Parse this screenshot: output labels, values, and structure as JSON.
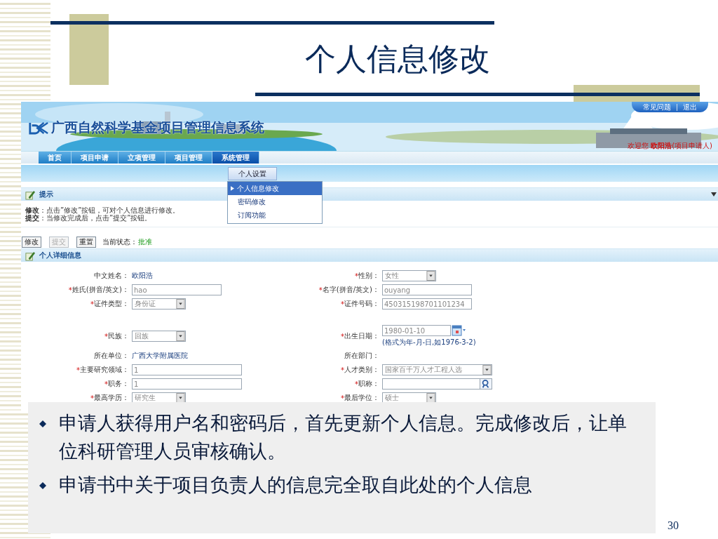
{
  "slide": {
    "title": "个人信息修改",
    "page_number": "30",
    "bullets": [
      "申请人获得用户名和密码后，首先更新个人信息。完成修改后，让单位科研管理人员审核确认。",
      "申请书中关于项目负责人的信息完全取自此处的个人信息"
    ]
  },
  "app": {
    "system_title": "广西自然科学基金项目管理信息系统",
    "top_links": [
      "常见问题",
      "退出"
    ],
    "welcome": "欢迎您 **欧阳浩**(项目申请人)",
    "nav": [
      {
        "label": "首页",
        "selected": false
      },
      {
        "label": "项目申请",
        "selected": false
      },
      {
        "label": "立项管理",
        "selected": false
      },
      {
        "label": "项目管理",
        "selected": false
      },
      {
        "label": "系统管理",
        "selected": true
      }
    ],
    "submenu": "个人设置",
    "dropdown": [
      {
        "label": "个人信息修改",
        "selected": true
      },
      {
        "label": "密码修改",
        "selected": false
      },
      {
        "label": "订阅功能",
        "selected": false
      }
    ],
    "tips_panel": {
      "title": "提示",
      "lines": [
        "**修改**：点击”修改”按钮，可对个人信息进行修改。",
        "**提交**：当修改完成后，点击”提交”按钮。"
      ]
    },
    "actions": [
      {
        "label": "修改",
        "disabled": false
      },
      {
        "label": "提交",
        "disabled": true
      },
      {
        "label": "重置",
        "disabled": false
      }
    ],
    "status": {
      "label": "当前状态：",
      "value": "批准"
    },
    "detail_panel": {
      "title": "个人详细信息",
      "rows": [
        {
          "left": {
            "label": "中文姓名：",
            "kind": "text",
            "value": "欧阳浩"
          },
          "right": {
            "mark": "*",
            "label": "性别：",
            "kind": "select",
            "value": "女性"
          }
        },
        {
          "left": {
            "mark": "*",
            "label": "姓氏(拼音/英文)：",
            "kind": "input",
            "value": "hao"
          },
          "right": {
            "mark": "*",
            "label": "名字(拼音/英文)：",
            "kind": "input",
            "value": "ouyang"
          }
        },
        {
          "left": {
            "mark": "*",
            "label": "证件类型：",
            "kind": "select",
            "value": "身份证"
          },
          "right": {
            "mark": "*",
            "label": "证件号码：",
            "kind": "input",
            "value": "450315198701101234"
          }
        },
        {
          "left": {
            "mark": "*",
            "label": "民族：",
            "kind": "select",
            "value": "回族"
          },
          "right": {
            "mark": "*",
            "label": "出生日期：",
            "kind": "date",
            "value": "1980-01-10",
            "hint": "(格式为年-月-日,如1976-3-2)"
          }
        },
        {
          "left": {
            "label": "所在单位：",
            "kind": "text",
            "value": "广西大学附属医院"
          },
          "right": {
            "label": "所在部门：",
            "kind": "text"
          }
        },
        {
          "left": {
            "mark": "*",
            "label": "主要研究领域：",
            "kind": "input",
            "wide": true,
            "value": "1"
          },
          "right": {
            "mark": "*",
            "label": "人才类别：",
            "kind": "select",
            "wide": true,
            "value": "国家百千万人才工程人选"
          }
        },
        {
          "left": {
            "mark": "*",
            "label": "职务：",
            "kind": "input",
            "wide": true,
            "value": "1"
          },
          "right": {
            "mark": "*",
            "label": "职称：",
            "kind": "lookup"
          }
        },
        {
          "left": {
            "mark": "*",
            "label": "最高学历：",
            "kind": "select",
            "value": "研究生"
          },
          "right": {
            "mark": "*",
            "label": "最后学位：",
            "kind": "select",
            "value": "硕士"
          }
        }
      ]
    }
  }
}
